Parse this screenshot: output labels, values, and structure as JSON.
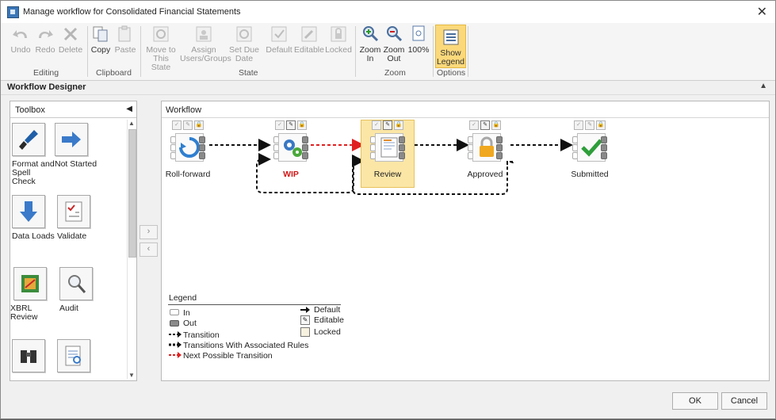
{
  "window": {
    "title": "Manage workflow for Consolidated Financial Statements",
    "close": "✕"
  },
  "ribbon": {
    "editing": {
      "label": "Editing",
      "undo": "Undo",
      "redo": "Redo",
      "delete": "Delete"
    },
    "clipboard": {
      "label": "Clipboard",
      "copy": "Copy",
      "paste": "Paste"
    },
    "state": {
      "label": "State",
      "move_line1": "Move to",
      "move_line2": "This State",
      "assign_line1": "Assign",
      "assign_line2": "Users/Groups",
      "due_line1": "Set Due",
      "due_line2": "Date",
      "default": "Default",
      "editable": "Editable",
      "locked": "Locked"
    },
    "zoom": {
      "label": "Zoom",
      "zoom_in_line1": "Zoom",
      "zoom_in_line2": "In",
      "zoom_out_line1": "Zoom",
      "zoom_out_line2": "Out",
      "hundred": "100%"
    },
    "options": {
      "label": "Options",
      "show_line1": "Show",
      "show_line2": "Legend"
    }
  },
  "designer": {
    "title": "Workflow Designer"
  },
  "toolbox": {
    "title": "Toolbox",
    "items": [
      {
        "line1": "Format and",
        "line2": "Spell Check"
      },
      {
        "line1": "Not Started",
        "line2": ""
      },
      {
        "line1": "Data Loads",
        "line2": ""
      },
      {
        "line1": "Validate",
        "line2": ""
      },
      {
        "line1": "XBRL Review",
        "line2": ""
      },
      {
        "line1": "Audit",
        "line2": ""
      }
    ]
  },
  "movers": {
    "right": "›",
    "left": "‹"
  },
  "workflow": {
    "title": "Workflow",
    "nodes": [
      {
        "label": "Roll-forward"
      },
      {
        "label": "WIP"
      },
      {
        "label": "Review"
      },
      {
        "label": "Approved"
      },
      {
        "label": "Submitted"
      }
    ],
    "colors": {
      "wip_label": "#d01818",
      "next_transition": "#e02020",
      "selected": "#fbe6a6"
    }
  },
  "legend": {
    "title": "Legend",
    "in": "In",
    "out": "Out",
    "transition": "Transition",
    "rules": "Transitions With Associated Rules",
    "next": "Next Possible Transition",
    "default": "Default",
    "editable": "Editable",
    "locked": "Locked"
  },
  "buttons": {
    "ok": "OK",
    "cancel": "Cancel"
  }
}
